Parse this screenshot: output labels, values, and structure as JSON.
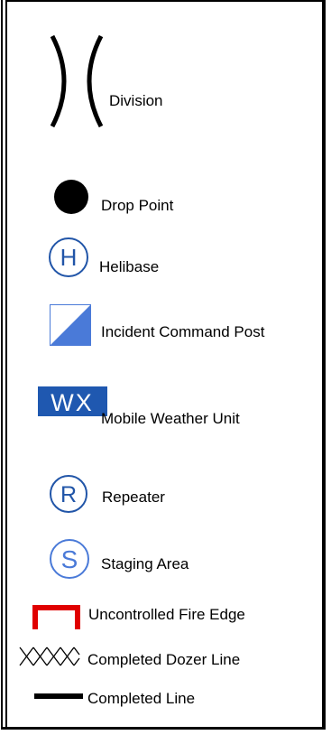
{
  "legend": {
    "items": [
      {
        "key": "division",
        "label": "Division",
        "icon": "division-brackets-icon"
      },
      {
        "key": "drop_point",
        "label": "Drop Point",
        "icon": "filled-circle-icon"
      },
      {
        "key": "helibase",
        "label": "Helibase",
        "icon": "h-circle-icon",
        "glyph": "H"
      },
      {
        "key": "icp",
        "label": "Incident Command Post",
        "icon": "icp-square-icon"
      },
      {
        "key": "weather",
        "label": "Mobile Weather Unit",
        "icon": "wx-box-icon",
        "glyph": "WX"
      },
      {
        "key": "repeater",
        "label": "Repeater",
        "icon": "r-circle-icon",
        "glyph": "R"
      },
      {
        "key": "staging",
        "label": "Staging Area",
        "icon": "s-circle-icon",
        "glyph": "S"
      },
      {
        "key": "fire_edge",
        "label": "Uncontrolled Fire Edge",
        "icon": "red-bracket-icon"
      },
      {
        "key": "dozer",
        "label": "Completed Dozer Line",
        "icon": "crosshatch-line-icon"
      },
      {
        "key": "line",
        "label": "Completed Line",
        "icon": "thick-line-icon"
      }
    ]
  },
  "colors": {
    "blue": "#2155a8",
    "icp_blue": "#4a7ad8",
    "wx_blue": "#1f58b0",
    "red": "#e00000",
    "black": "#000000"
  }
}
